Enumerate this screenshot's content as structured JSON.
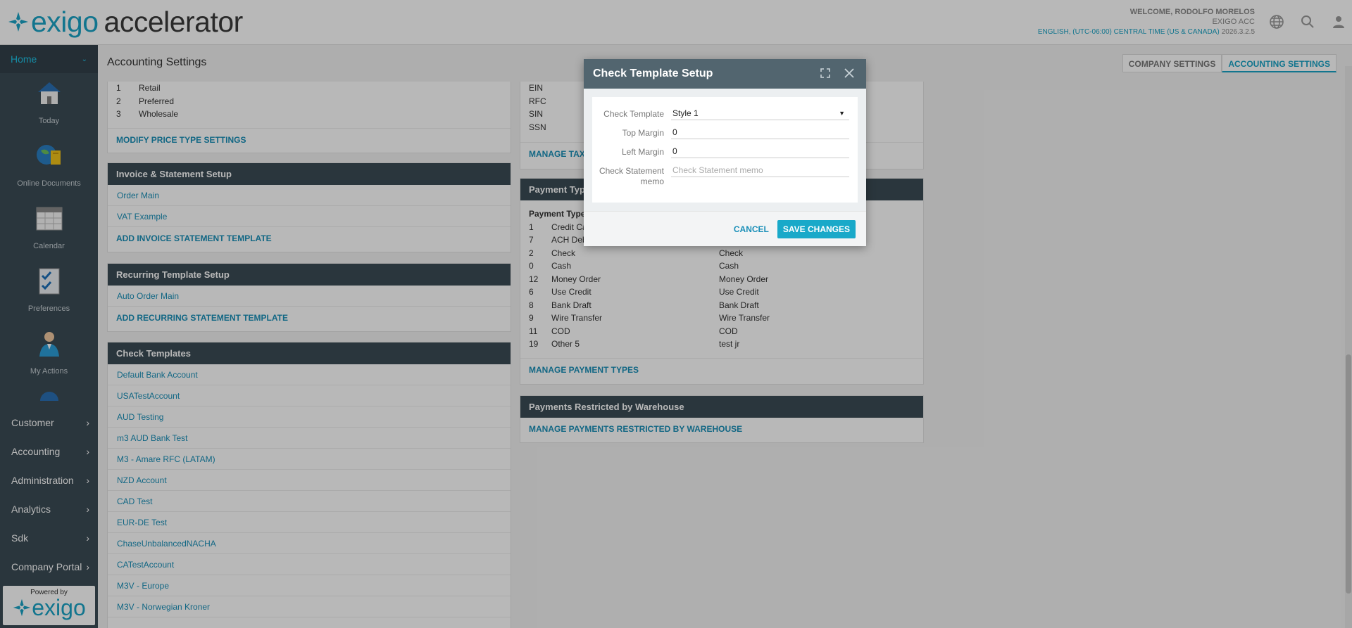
{
  "header": {
    "logo_left": "exigo",
    "logo_right": "accelerator",
    "welcome": "WELCOME, RODOLFO MORELOS",
    "company": "EXIGO ACC",
    "locale": "ENGLISH, (UTC-06:00) CENTRAL TIME (US & CANADA)",
    "version": "2026.3.2.5",
    "icons": [
      "globe-icon",
      "search-icon",
      "user-icon"
    ]
  },
  "sidebar": {
    "home_label": "Home",
    "apps": [
      {
        "label": "Today",
        "icon": "house-icon"
      },
      {
        "label": "Online Documents",
        "icon": "globe-documents-icon"
      },
      {
        "label": "Calendar",
        "icon": "calendar-icon"
      },
      {
        "label": "Preferences",
        "icon": "checklist-icon"
      },
      {
        "label": "My Actions",
        "icon": "person-icon"
      }
    ],
    "menu": [
      {
        "label": "Customer"
      },
      {
        "label": "Accounting"
      },
      {
        "label": "Administration"
      },
      {
        "label": "Analytics"
      },
      {
        "label": "Sdk"
      },
      {
        "label": "Company Portal"
      }
    ],
    "powered_by": "Powered by",
    "powered_logo": "exigo"
  },
  "main": {
    "title": "Accounting Settings",
    "tabs": [
      {
        "label": "COMPANY SETTINGS",
        "active": false
      },
      {
        "label": "ACCOUNTING SETTINGS",
        "active": true
      }
    ],
    "price_types": [
      {
        "n": "1",
        "d": "Retail"
      },
      {
        "n": "2",
        "d": "Preferred"
      },
      {
        "n": "3",
        "d": "Wholesale"
      }
    ],
    "price_types_action": "MODIFY PRICE TYPE SETTINGS",
    "invoice": {
      "title": "Invoice & Statement Setup",
      "items": [
        "Order Main",
        "VAT Example"
      ],
      "action": "ADD INVOICE STATEMENT TEMPLATE"
    },
    "recurring": {
      "title": "Recurring Template Setup",
      "items": [
        "Auto Order Main"
      ],
      "action": "ADD RECURRING STATEMENT TEMPLATE"
    },
    "checks": {
      "title": "Check Templates",
      "items": [
        "Default Bank Account",
        "USATestAccount",
        "AUD Testing",
        "m3 AUD Bank Test",
        "M3 - Amare RFC (LATAM)",
        "NZD Account",
        "CAD Test",
        "EUR-DE Test",
        "ChaseUnbalancedNACHA",
        "CATestAccount",
        "M3V - Europe",
        "M3V - Norwegian Kroner"
      ]
    },
    "tax_ids": [
      "EIN",
      "RFC",
      "SIN",
      "SSN"
    ],
    "tax_action": "MANAGE TAX T",
    "payment": {
      "title": "Payment Type",
      "col_header": "Payment Type",
      "rows": [
        {
          "n": "1",
          "d": "Credit Ca",
          "d2": ""
        },
        {
          "n": "7",
          "d": "ACH Deb",
          "d2": ""
        },
        {
          "n": "2",
          "d": "Check",
          "d2": "Check"
        },
        {
          "n": "0",
          "d": "Cash",
          "d2": "Cash"
        },
        {
          "n": "12",
          "d": "Money Order",
          "d2": "Money Order"
        },
        {
          "n": "6",
          "d": "Use Credit",
          "d2": "Use Credit"
        },
        {
          "n": "8",
          "d": "Bank Draft",
          "d2": "Bank Draft"
        },
        {
          "n": "9",
          "d": "Wire Transfer",
          "d2": "Wire Transfer"
        },
        {
          "n": "11",
          "d": "COD",
          "d2": "COD"
        },
        {
          "n": "19",
          "d": "Other 5",
          "d2": "test jr"
        }
      ],
      "action": "MANAGE PAYMENT TYPES"
    },
    "restricted": {
      "title": "Payments Restricted by Warehouse",
      "action": "MANAGE PAYMENTS RESTRICTED BY WAREHOUSE"
    }
  },
  "dialog": {
    "title": "Check Template Setup",
    "fields": {
      "template_label": "Check Template",
      "template_value": "Style 1",
      "top_margin_label": "Top Margin",
      "top_margin_value": "0",
      "left_margin_label": "Left Margin",
      "left_margin_value": "0",
      "memo_label": "Check Statement memo",
      "memo_placeholder": "Check Statement memo"
    },
    "cancel": "CANCEL",
    "save": "SAVE CHANGES"
  }
}
